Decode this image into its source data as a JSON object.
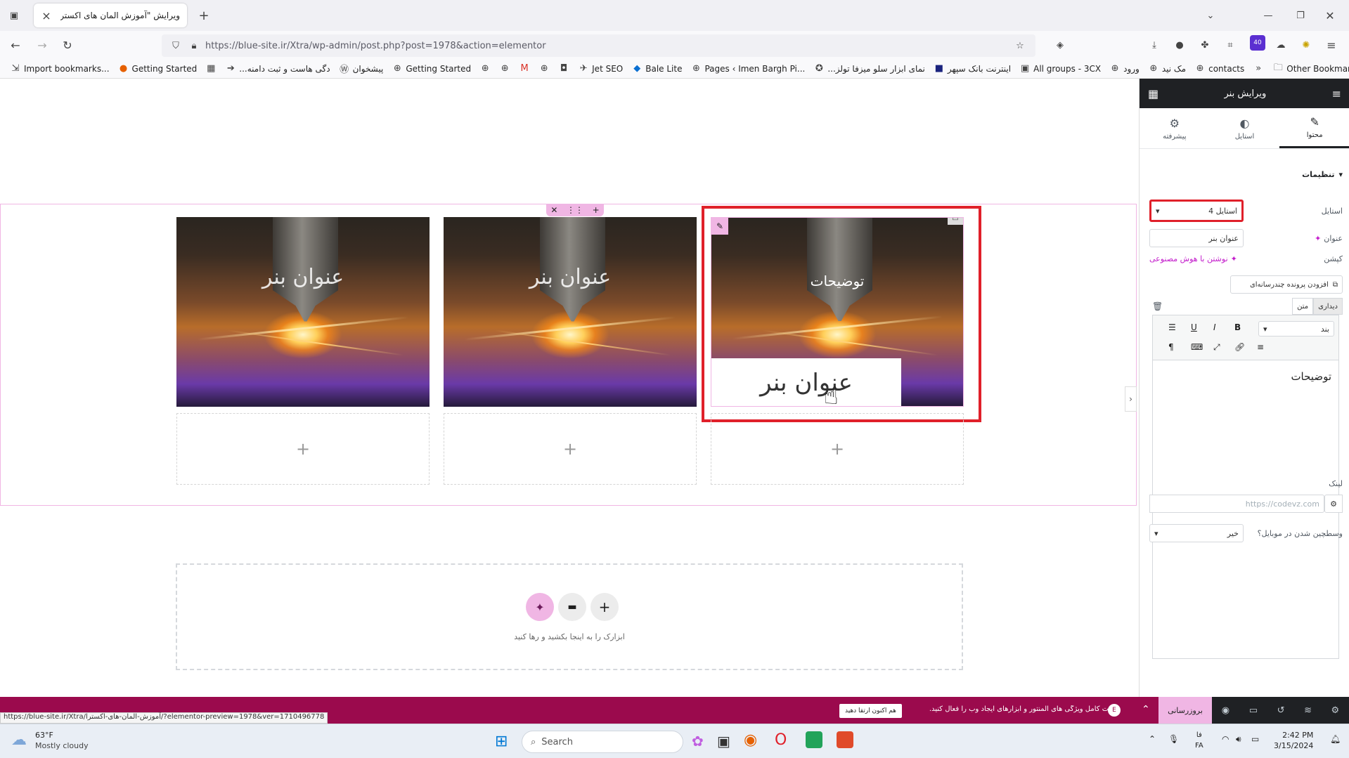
{
  "browser": {
    "tab_title": "ویرایش \"آموزش المان های اکسترا - ...",
    "url": "https://blue-site.ir/Xtra/wp-admin/post.php?post=1978&action=elementor",
    "extension_badge": "40",
    "bookmarks": [
      "Import bookmarks...",
      "Getting Started",
      "...دگی هاست و ثبت دامنه",
      "پیشخوان",
      "Getting Started",
      "Jet SEO",
      "Bale Lite",
      "Pages ‹ Imen Bargh Pi...",
      "...نمای ابزار سلو میزفا تولز",
      "اینترنت بانک سپهر",
      "All groups - 3CX",
      "ورود",
      "مک نید",
      "contacts"
    ],
    "other_bookmarks": "Other Bookmarks"
  },
  "canvas": {
    "banners": [
      {
        "title": "عنوان بنر"
      },
      {
        "title": "عنوان بنر"
      },
      {
        "title": "عنوان بنر",
        "description": "توضیحات"
      }
    ],
    "add_plus": "+",
    "drop_text": "ابزارک را به اینجا بکشید و رها کنید"
  },
  "panel": {
    "header_title": "ویرایش بنر",
    "tabs": [
      "محتوا",
      "استایل",
      "پیشرفته"
    ],
    "section_title": "تنظیمات",
    "style_label": "استایل",
    "style_value": "استایل 4",
    "title_label": "عنوان",
    "title_value": "عنوان بنر",
    "caption_label": "کپشن",
    "ai_write": "نوشتن با هوش مصنوعی",
    "add_media": "افزودن پرونده چندرسانه‌ای",
    "editor_tabs": [
      "دیداری",
      "متن"
    ],
    "paragraph": "بند",
    "editor_content": "توضیحات",
    "link_label": "لینک",
    "link_placeholder": "https://codevz.com",
    "mobile_label": "وسطچین شدن در موبایل؟",
    "mobile_value": "خیر"
  },
  "elementor_bar": {
    "update_button": "بروزرسانی",
    "promo_text": "قدرت کامل ویژگی های المنتور و ابزارهای ایجاد وب را فعال کنید.",
    "promo_button": "هم اکنون ارتقا دهید",
    "status_url": "https://blue-site.ir/Xtra/آموزش-المان-های-اکسترا/?elementor-preview=1978&ver=1710496778"
  },
  "taskbar": {
    "weather_temp": "63°F",
    "weather_desc": "Mostly cloudy",
    "search_placeholder": "Search",
    "lang1": "فا",
    "lang2": "FA",
    "time": "2:42 PM",
    "date": "3/15/2024"
  },
  "colors": {
    "accent_pink": "#f0b6e4",
    "elementor_maroon": "#9b0a4d",
    "highlight_red": "#e0202a",
    "ai_purple": "#c31ccb"
  }
}
